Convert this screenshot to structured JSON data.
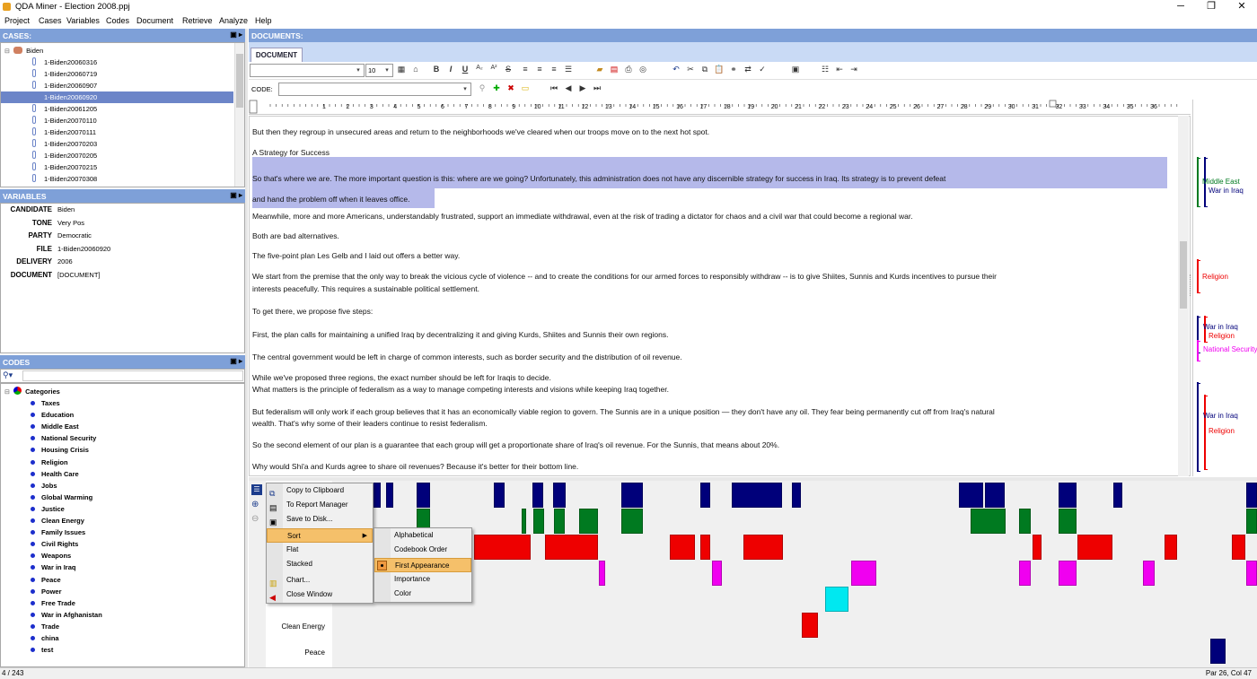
{
  "window": {
    "title": "QDA Miner - Election 2008.ppj"
  },
  "menu": [
    "Project",
    "Cases",
    "Variables",
    "Codes",
    "Document",
    "Retrieve",
    "Analyze",
    "Help"
  ],
  "cases": {
    "header": "CASES:",
    "root": "Biden",
    "items": [
      "1-Biden20060316",
      "1-Biden20060719",
      "1-Biden20060907",
      "1-Biden20060920",
      "1-Biden20061205",
      "1-Biden20070110",
      "1-Biden20070111",
      "1-Biden20070203",
      "1-Biden20070205",
      "1-Biden20070215",
      "1-Biden20070308"
    ],
    "selected_index": 3
  },
  "variables": {
    "header": "VARIABLES",
    "rows": [
      {
        "name": "CANDIDATE",
        "value": "Biden"
      },
      {
        "name": "TONE",
        "value": "Very Pos"
      },
      {
        "name": "PARTY",
        "value": "Democratic"
      },
      {
        "name": "FILE",
        "value": "1-Biden20060920"
      },
      {
        "name": "DELIVERY",
        "value": "2006"
      },
      {
        "name": "DOCUMENT",
        "value": "[DOCUMENT]"
      }
    ]
  },
  "codes": {
    "header": "CODES",
    "root": "Categories",
    "items": [
      "Taxes",
      "Education",
      "Middle East",
      "National Security",
      "Housing Crisis",
      "Religion",
      "Health Care",
      "Jobs",
      "Global Warming",
      "Justice",
      "Clean Energy",
      "Family Issues",
      "Civil Rights",
      "Weapons",
      "War in Iraq",
      "Peace",
      "Power",
      "Free Trade",
      "War in Afghanistan",
      "Trade",
      "china",
      "test"
    ]
  },
  "documents": {
    "header": "DOCUMENTS:",
    "tab": "DOCUMENT",
    "font_size": "10",
    "code_label": "CODE:",
    "ruler_numbers": [
      "1",
      "2",
      "3",
      "4",
      "5",
      "6",
      "7",
      "8",
      "9",
      "10",
      "11",
      "12",
      "13",
      "14",
      "15",
      "16",
      "17",
      "18",
      "19",
      "20",
      "21",
      "22",
      "23",
      "24",
      "25",
      "26",
      "27",
      "28",
      "29",
      "30",
      "31",
      "32",
      "33",
      "34",
      "35",
      "36"
    ]
  },
  "paragraphs": [
    "But then they regroup in unsecured areas and return to the neighborhoods we've cleared when our troops move on to the next hot spot.",
    "A Strategy for Success",
    "So that's where we are. The more important question is this: where are we going? Unfortunately, this administration does not have any discernible strategy for success in Iraq. Its strategy is to prevent defeat",
    "and hand the problem off when it leaves office.",
    "Meanwhile, more and more Americans, understandably frustrated, support an immediate withdrawal, even at the risk of trading a dictator for chaos and a civil war that could become a regional war.",
    "Both are bad alternatives.",
    "The five-point plan Les Gelb and I laid out offers a better way.",
    "We start from the premise that the only way to break the vicious cycle of violence -- and to create the conditions for our armed forces to responsibly withdraw -- is to give Shiites, Sunnis and Kurds incentives to pursue their",
    "interests peacefully. This requires a sustainable political settlement.",
    "To get there, we propose five steps:",
    "First, the plan calls for maintaining a unified Iraq by decentralizing it and giving Kurds, Shiites and Sunnis their own regions.",
    "The central government would be left in charge of common interests, such as border security and the distribution of oil revenue.",
    "While we've proposed three regions, the exact number should be left for Iraqis to decide.",
    "What matters is the principle of federalism as a way to manage competing interests and visions while keeping Iraq together.",
    "But federalism will only work if each group believes that it has an economically viable region to govern. The Sunnis are in a unique position — they don't have any oil. They fear being permanently cut off from Iraq's natural",
    "wealth. That's why some of their leaders continue to resist federalism.",
    "So the second element of our plan is a guarantee that each group will get a proportionate share of Iraq's oil revenue. For the Sunnis, that means about 20%.",
    "Why would Shi'a and Kurds agree to share oil revenues? Because it's better for their bottom line."
  ],
  "margin_codes": [
    "Middle East",
    "War in Iraq",
    "Religion",
    "War in Iraq",
    "Religion",
    "National Security",
    "War in Iraq",
    "Religion"
  ],
  "colors": {
    "navy": "#00007a",
    "green": "#007a20",
    "red": "#ee0000",
    "magenta": "#f000f0",
    "cyan": "#00e8f0",
    "highlight": "#b5b9ea",
    "header_blue": "#7ea0d8"
  },
  "chart": {
    "row_labels": [
      "Clean Energy",
      "Peace"
    ]
  },
  "context_menu": {
    "items": [
      "Copy to Clipboard",
      "To Report Manager",
      "Save to Disk...",
      "Sort",
      "Flat",
      "Stacked",
      "Chart...",
      "Close Window"
    ],
    "submenu": [
      "Alphabetical",
      "Codebook Order",
      "First Appearance",
      "Importance",
      "Color"
    ],
    "submenu_selected": "First Appearance"
  },
  "status": {
    "left": "4 / 243",
    "right": "Par 26, Col 47"
  }
}
